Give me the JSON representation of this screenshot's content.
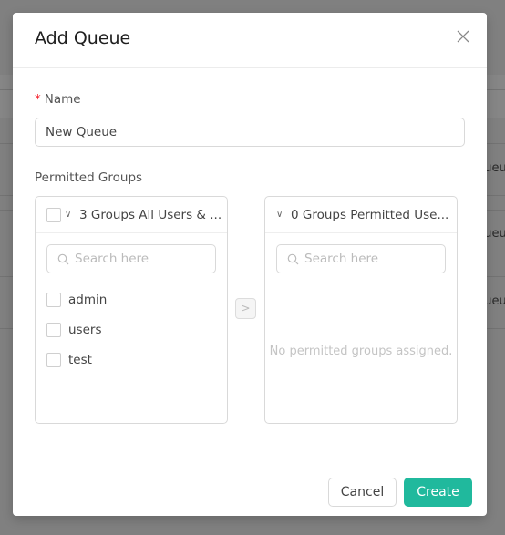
{
  "background": {
    "row_texts": [
      "Queue",
      "Queue",
      "Queue"
    ]
  },
  "modal": {
    "title": "Add Queue",
    "name_label": "Name",
    "required_mark": "*",
    "name_value": "New Queue",
    "permitted_groups_label": "Permitted Groups",
    "source_panel": {
      "header": "3 Groups All Users & ...",
      "search_placeholder": "Search here",
      "items": [
        {
          "label": "admin",
          "checked": false
        },
        {
          "label": "users",
          "checked": false
        },
        {
          "label": "test",
          "checked": false
        }
      ]
    },
    "target_panel": {
      "header": "0 Groups Permitted Use...",
      "search_placeholder": "Search here",
      "empty_text": "No permitted groups assigned."
    },
    "move_right_label": ">",
    "cancel_label": "Cancel",
    "create_label": "Create"
  },
  "colors": {
    "primary": "#20b99d",
    "required": "#f5222d",
    "overlay": "#808080"
  }
}
